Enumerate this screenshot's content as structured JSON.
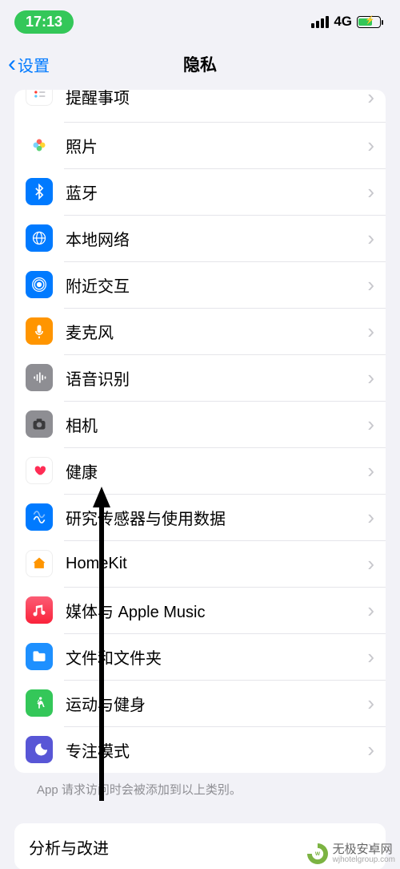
{
  "status": {
    "time": "17:13",
    "network": "4G"
  },
  "nav": {
    "back": "设置",
    "title": "隐私"
  },
  "rows": [
    {
      "key": "reminders",
      "label": "提醒事项",
      "iconClass": "ic-reminders",
      "iconName": "reminders-icon"
    },
    {
      "key": "photos",
      "label": "照片",
      "iconClass": "ic-photos",
      "iconName": "photos-icon"
    },
    {
      "key": "bluetooth",
      "label": "蓝牙",
      "iconClass": "ic-bt",
      "iconName": "bluetooth-icon"
    },
    {
      "key": "local-network",
      "label": "本地网络",
      "iconClass": "ic-net",
      "iconName": "local-network-icon"
    },
    {
      "key": "nearby",
      "label": "附近交互",
      "iconClass": "ic-nearby",
      "iconName": "nearby-icon"
    },
    {
      "key": "microphone",
      "label": "麦克风",
      "iconClass": "ic-mic",
      "iconName": "microphone-icon"
    },
    {
      "key": "speech",
      "label": "语音识别",
      "iconClass": "ic-speech",
      "iconName": "speech-icon"
    },
    {
      "key": "camera",
      "label": "相机",
      "iconClass": "ic-camera",
      "iconName": "camera-icon"
    },
    {
      "key": "health",
      "label": "健康",
      "iconClass": "ic-health",
      "iconName": "health-icon"
    },
    {
      "key": "research",
      "label": "研究传感器与使用数据",
      "iconClass": "ic-research",
      "iconName": "research-icon"
    },
    {
      "key": "homekit",
      "label": "HomeKit",
      "iconClass": "ic-home",
      "iconName": "homekit-icon"
    },
    {
      "key": "media",
      "label": "媒体与 Apple Music",
      "iconClass": "ic-music",
      "iconName": "music-icon"
    },
    {
      "key": "files",
      "label": "文件和文件夹",
      "iconClass": "ic-files",
      "iconName": "files-icon"
    },
    {
      "key": "fitness",
      "label": "运动与健身",
      "iconClass": "ic-fitness",
      "iconName": "fitness-icon"
    },
    {
      "key": "focus",
      "label": "专注模式",
      "iconClass": "ic-focus",
      "iconName": "focus-icon"
    }
  ],
  "footer": "App 请求访问时会被添加到以上类别。",
  "section2_label": "分析与改进",
  "watermark": {
    "cn": "无极安卓网",
    "en": "wjhotelgroup.com"
  }
}
